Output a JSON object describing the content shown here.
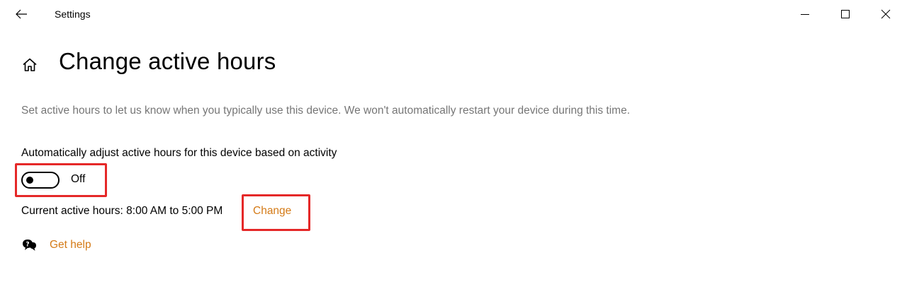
{
  "window": {
    "title": "Settings",
    "controls": {
      "back_icon": "arrow-left-icon",
      "minimize_icon": "minimize-icon",
      "maximize_icon": "maximize-icon",
      "close_icon": "close-icon"
    }
  },
  "page": {
    "home_icon": "home-icon",
    "title": "Change active hours",
    "description": "Set active hours to let us know when you typically use this device. We won't automatically restart your device during this time."
  },
  "auto_adjust": {
    "label": "Automatically adjust active hours for this device based on activity",
    "state": "Off"
  },
  "active_hours": {
    "current_text": "Current active hours: 8:00 AM to 5:00 PM",
    "change_label": "Change"
  },
  "help": {
    "icon": "help-chat-icon",
    "label": "Get help"
  },
  "colors": {
    "accent_link": "#d47a16",
    "highlight_box": "#e52828",
    "description_text": "#767676"
  }
}
